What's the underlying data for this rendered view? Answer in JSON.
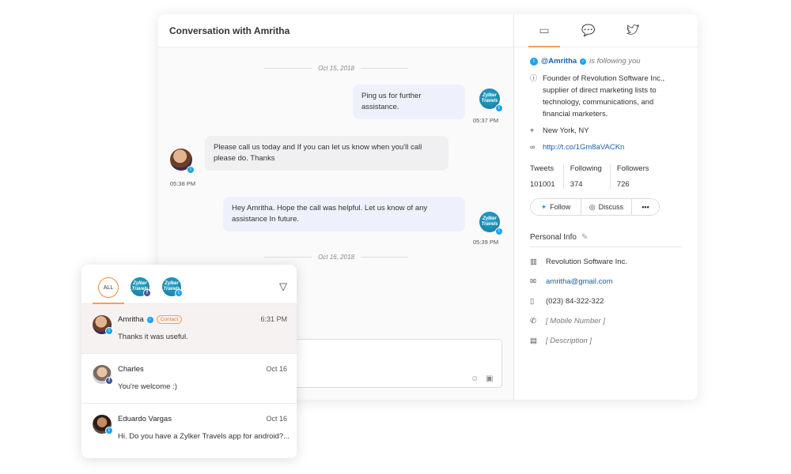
{
  "conversation": {
    "title": "Conversation with Amritha",
    "dates": [
      "Oct 15, 2018",
      "Oct 16, 2018"
    ],
    "brand_avatar_text": "Zylker Travels",
    "messages": [
      {
        "text": "Ping us for further assistance.",
        "time": "05:37 PM",
        "direction": "out"
      },
      {
        "text": "Please call us today and If you can let us know when you'll call please do. Thanks",
        "time": "05:38 PM",
        "direction": "in"
      },
      {
        "text": "Hey Amritha. Hope the call was helpful. Let us know of any assistance In future.",
        "time": "05:39 PM",
        "direction": "out"
      }
    ]
  },
  "profile": {
    "tabs": [
      "contact-card-icon",
      "chat-bubbles-icon",
      "twitter-icon"
    ],
    "handle": "@Amritha",
    "following_text": "is following you",
    "bio": "Founder of Revolution Software Inc., supplier of direct marketing lists to technology, communications, and financial marketers.",
    "location": "New York, NY",
    "url": "http://t.co/1Gm8aVACKn",
    "stats": [
      {
        "label": "Tweets",
        "value": "101001"
      },
      {
        "label": "Following",
        "value": "374"
      },
      {
        "label": "Followers",
        "value": "726"
      }
    ],
    "actions": {
      "follow": "Follow",
      "discuss": "Discuss",
      "more": "•••"
    },
    "personal_info": {
      "title": "Personal Info",
      "company": "Revolution Software Inc.",
      "email": "amritha@gmail.com",
      "phone": "(023) 84-322-322",
      "mobile_placeholder": "[ Mobile Number ]",
      "description_placeholder": "[ Description ]"
    }
  },
  "inbox": {
    "filter_all": "ALL",
    "items": [
      {
        "name": "Amritha",
        "tag": "Contact",
        "time": "6:31 PM",
        "message": "Thanks it was useful.",
        "channel": "twitter",
        "selected": true
      },
      {
        "name": "Charles",
        "tag": "",
        "time": "Oct 16",
        "message": "You're welcome :)",
        "channel": "facebook",
        "selected": false
      },
      {
        "name": "Eduardo Vargas",
        "tag": "",
        "time": "Oct 16",
        "message": "Hi. Do you have a Zylker Travels app for android?...",
        "channel": "twitter",
        "selected": false
      }
    ]
  },
  "colors": {
    "accent": "#f0a060",
    "twitter": "#1da1f2",
    "facebook": "#3b5998",
    "link": "#1b5fa8"
  }
}
